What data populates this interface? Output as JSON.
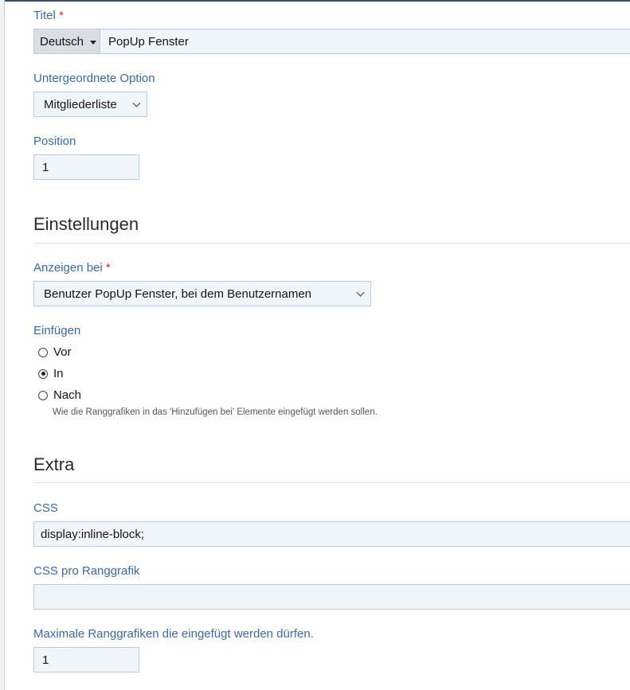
{
  "fields": {
    "title": {
      "label": "Titel",
      "required_mark": "*",
      "language": "Deutsch",
      "value": "PopUp Fenster"
    },
    "sub_option": {
      "label": "Untergeordnete Option",
      "selected": "Mitgliederliste"
    },
    "position": {
      "label": "Position",
      "value": "1"
    }
  },
  "settings": {
    "heading": "Einstellungen",
    "display_at": {
      "label": "Anzeigen bei",
      "required_mark": "*",
      "selected": "Benutzer PopUp Fenster, bei dem Benutzernamen"
    },
    "insert": {
      "label": "Einfügen",
      "options": [
        {
          "label": "Vor",
          "checked": false
        },
        {
          "label": "In",
          "checked": true
        },
        {
          "label": "Nach",
          "checked": false
        }
      ],
      "hint": "Wie die Ranggrafiken in das 'Hinzufügen bei' Elemente eingefügt werden sollen."
    }
  },
  "extra": {
    "heading": "Extra",
    "css": {
      "label": "CSS",
      "value": "display:inline-block;"
    },
    "css_per_rank": {
      "label": "CSS pro Ranggrafik",
      "value": ""
    },
    "max_ranks": {
      "label": "Maximale Ranggrafiken die eingefügt werden dürfen.",
      "value": "1"
    }
  },
  "colors": {
    "label": "#3b6aa0",
    "required": "#d9322a",
    "input_bg": "#f0f5fa",
    "input_border": "#b8cde0",
    "addon_bg": "#dadee3"
  }
}
